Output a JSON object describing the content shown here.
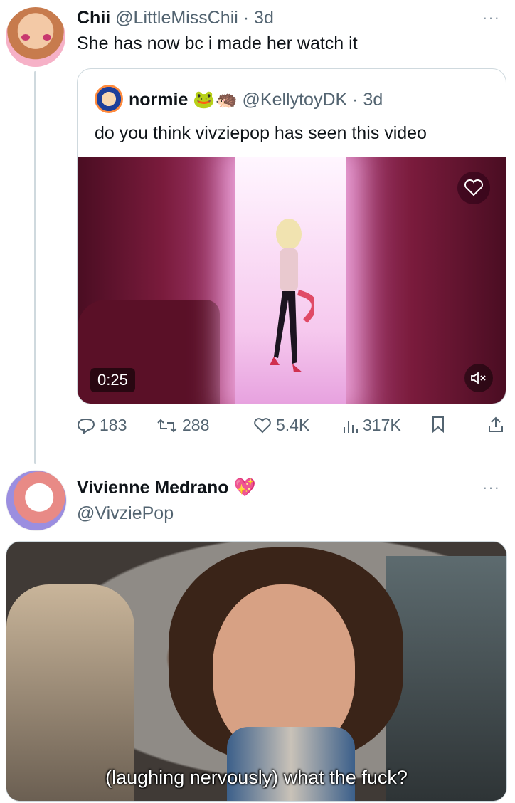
{
  "reply_tweet": {
    "display_name": "Chii",
    "handle": "@LittleMissChii",
    "time": "3d",
    "text": "She has now bc i made her watch it",
    "more": "···"
  },
  "quoted_tweet": {
    "display_name": "normie",
    "emojis": "🐸🦔",
    "handle": "@KellytoyDK",
    "time": "3d",
    "text": "do you think vivziepop has seen this video",
    "video_duration": "0:25"
  },
  "actions": {
    "replies": "183",
    "retweets": "288",
    "likes": "5.4K",
    "views": "317K"
  },
  "main_tweet": {
    "display_name": "Vivienne Medrano",
    "emoji": "💖",
    "handle": "@VivziePop",
    "more": "···",
    "image_caption": "(laughing nervously) what the fuck?"
  },
  "colors": {
    "text": "#0f1419",
    "muted": "#536471",
    "border": "#cfd9de"
  },
  "icons": [
    "reply-icon",
    "retweet-icon",
    "like-icon",
    "views-icon",
    "bookmark-icon",
    "share-icon",
    "mute-icon",
    "more-icon"
  ]
}
